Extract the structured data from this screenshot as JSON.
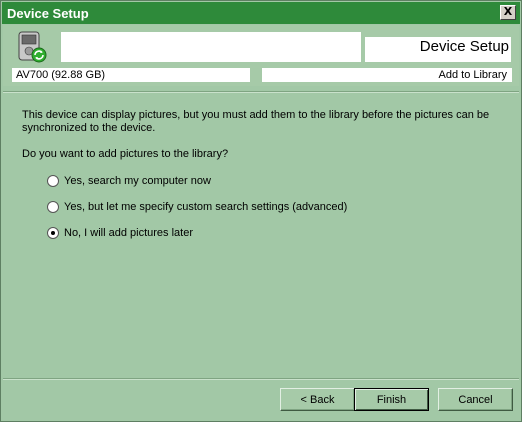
{
  "window": {
    "title": "Device Setup",
    "close_glyph": "X"
  },
  "header": {
    "title": "Device Setup",
    "device_name": "AV700 (92.88 GB)",
    "step": "Add to Library",
    "icon": "portable-device-icon"
  },
  "content": {
    "description": "This device can display pictures, but you must add them to the library before the pictures can be synchronized to the device.",
    "question": "Do you want to add pictures to the library?",
    "options": [
      {
        "label": "Yes, search my computer now",
        "selected": false
      },
      {
        "label": "Yes, but let me specify custom search settings (advanced)",
        "selected": false
      },
      {
        "label": "No, I will add pictures later",
        "selected": true
      }
    ]
  },
  "buttons": {
    "back": "< Back",
    "finish": "Finish",
    "cancel": "Cancel"
  },
  "colors": {
    "titlebar": "#2e8a3a",
    "background": "#a2c8a6"
  }
}
